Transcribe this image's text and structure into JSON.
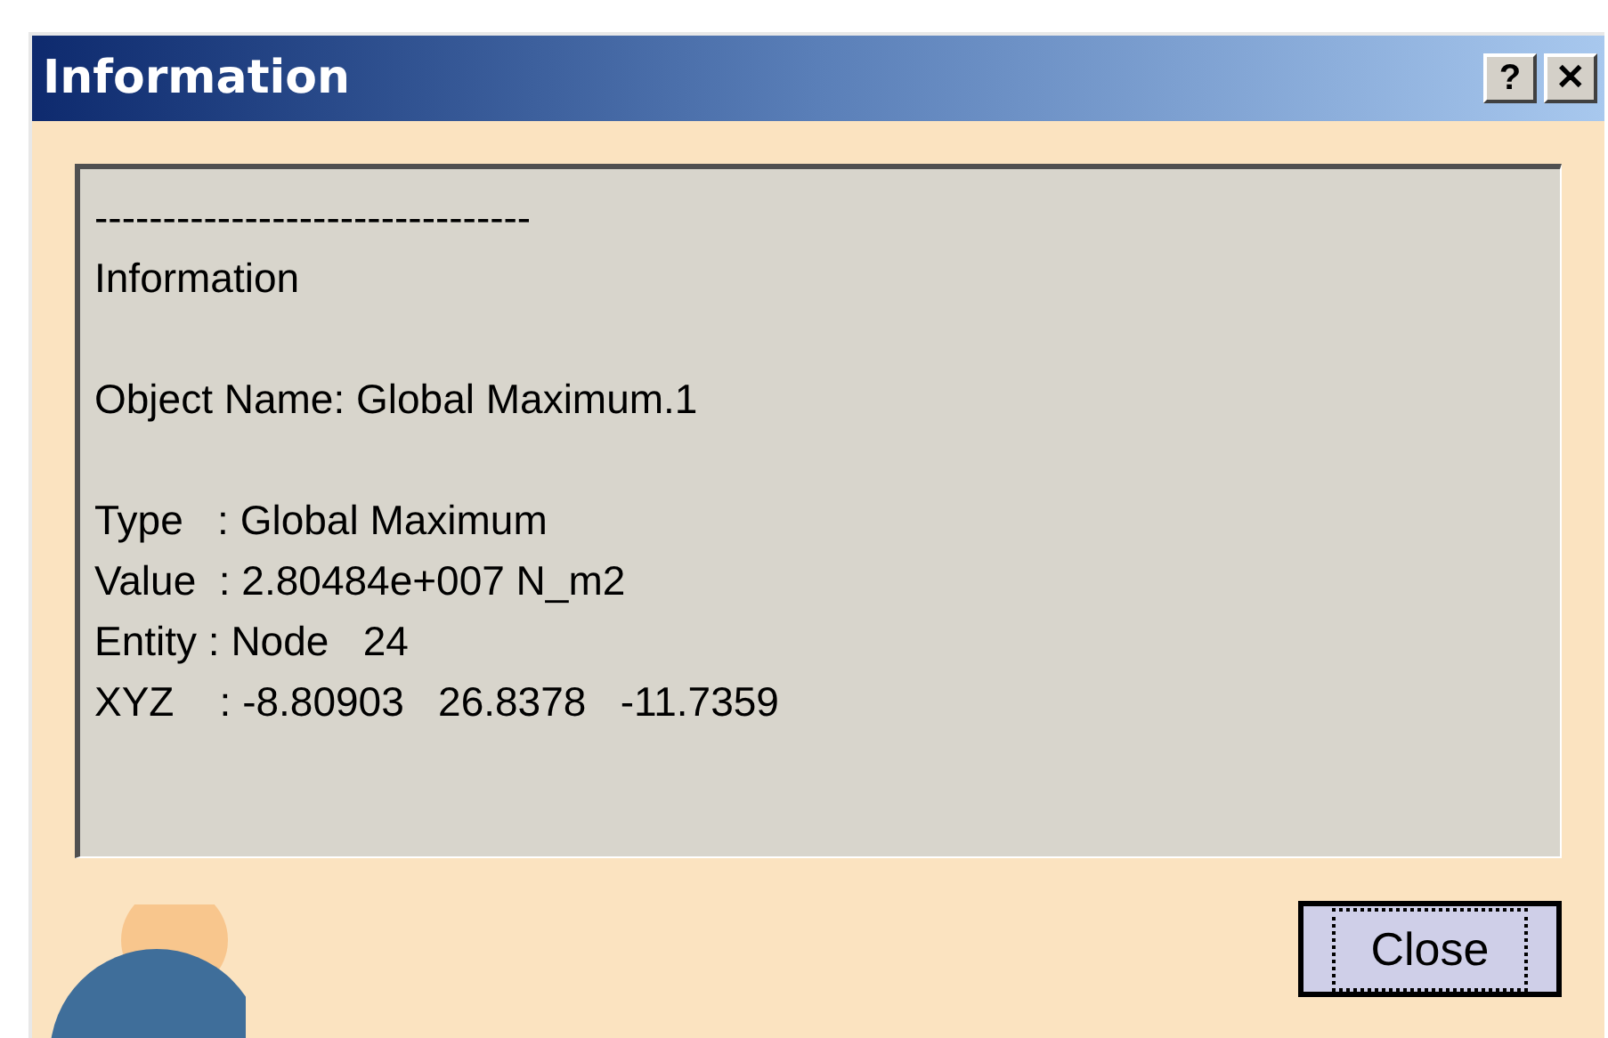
{
  "window": {
    "title": "Information",
    "title_buttons": [
      "?",
      "✕"
    ]
  },
  "text_blocks": [
    [
      "--------------------------------",
      "Information"
    ],
    [
      "Object Name: Global Maximum.1"
    ],
    [
      "Type   : Global Maximum",
      "Value  : 2.80484e+007 N_m2",
      "Entity : Node   24",
      "XYZ    : -8.80903   26.8378   -11.7359"
    ]
  ],
  "buttons": [
    {
      "label": "Close",
      "focused": true
    }
  ]
}
